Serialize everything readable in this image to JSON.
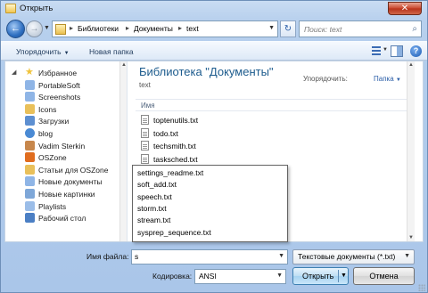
{
  "window": {
    "title": "Открыть"
  },
  "nav": {
    "breadcrumb": [
      "Библиотеки",
      "Документы",
      "text"
    ],
    "search_placeholder": "Поиск: text"
  },
  "toolbar": {
    "organize": "Упорядочить",
    "new_folder": "Новая папка"
  },
  "sidebar": {
    "items": [
      {
        "label": "Избранное",
        "icon": "star-icon",
        "color": "#f0c33c"
      },
      {
        "label": "PortableSoft",
        "icon": "folder-icon",
        "color": "#8fb5e6"
      },
      {
        "label": "Screenshots",
        "icon": "folder-icon",
        "color": "#8fb5e6"
      },
      {
        "label": "Icons",
        "icon": "folder-icon",
        "color": "#e9c05a"
      },
      {
        "label": "Загрузки",
        "icon": "downloads-icon",
        "color": "#5d8fd1"
      },
      {
        "label": "blog",
        "icon": "globe-icon",
        "color": "#4a8ad4"
      },
      {
        "label": "Vadim Sterkin",
        "icon": "user-icon",
        "color": "#c7874c"
      },
      {
        "label": "OSZone",
        "icon": "osz-icon",
        "color": "#e06d1f"
      },
      {
        "label": "Статьи для OSZone",
        "icon": "folder-icon",
        "color": "#e9c05a"
      },
      {
        "label": "Новые документы",
        "icon": "document-icon",
        "color": "#8fb5e6"
      },
      {
        "label": "Новые картинки",
        "icon": "picture-icon",
        "color": "#7ea7d8"
      },
      {
        "label": "Playlists",
        "icon": "playlist-icon",
        "color": "#9bbde8"
      },
      {
        "label": "Рабочий стол",
        "icon": "desktop-icon",
        "color": "#4b7fc4"
      }
    ]
  },
  "content": {
    "title": "Библиотека \"Документы\"",
    "subtitle": "text",
    "arrange_label": "Упорядочить:",
    "arrange_value": "Папка",
    "column_name": "Имя",
    "files": [
      "toptenutils.txt",
      "todo.txt",
      "techsmith.txt",
      "tasksched.txt"
    ]
  },
  "autocomplete": {
    "items": [
      "settings_readme.txt",
      "soft_add.txt",
      "speech.txt",
      "storm.txt",
      "stream.txt",
      "sysprep_sequence.txt"
    ]
  },
  "footer": {
    "filename_label": "Имя файла:",
    "filename_value": "s",
    "filetype_value": "Текстовые документы (*.txt)",
    "encoding_label": "Кодировка:",
    "encoding_value": "ANSI",
    "open_label": "Открыть",
    "cancel_label": "Отмена"
  }
}
